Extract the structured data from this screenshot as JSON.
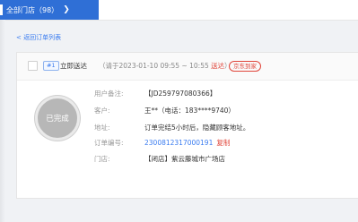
{
  "header": {
    "store_selector": "全部门店（98）",
    "chevron_icon": "chevron-right-icon"
  },
  "back_link": "< 返回订单列表",
  "order": {
    "order_index": "#1",
    "delivery_type": "立即送达",
    "arrival_prefix": "（请于2023-01-10 09:55 ~ 10:55 ",
    "arrival_status": "送达",
    "arrival_suffix": "）",
    "channel": "京东到家",
    "status": "已完成",
    "fields": {
      "remark_label": "用户备注:",
      "remark_value": "【JD259797080366】",
      "customer_label": "客户:",
      "customer_value": "王**（电话：183****9740）",
      "address_label": "地址:",
      "address_value": "订单完结5小时后，隐藏顾客地址。",
      "order_no_label": "订单编号:",
      "order_no_value": "2300812317000191",
      "copy_label": "复制",
      "store_label": "门店:",
      "store_value": "【闭店】紫云藤城市广场店"
    }
  },
  "colors": {
    "primary": "#2f6fd6",
    "link": "#3a7cf0",
    "alert": "#e0453a",
    "stamp": "#b7b7b7"
  }
}
